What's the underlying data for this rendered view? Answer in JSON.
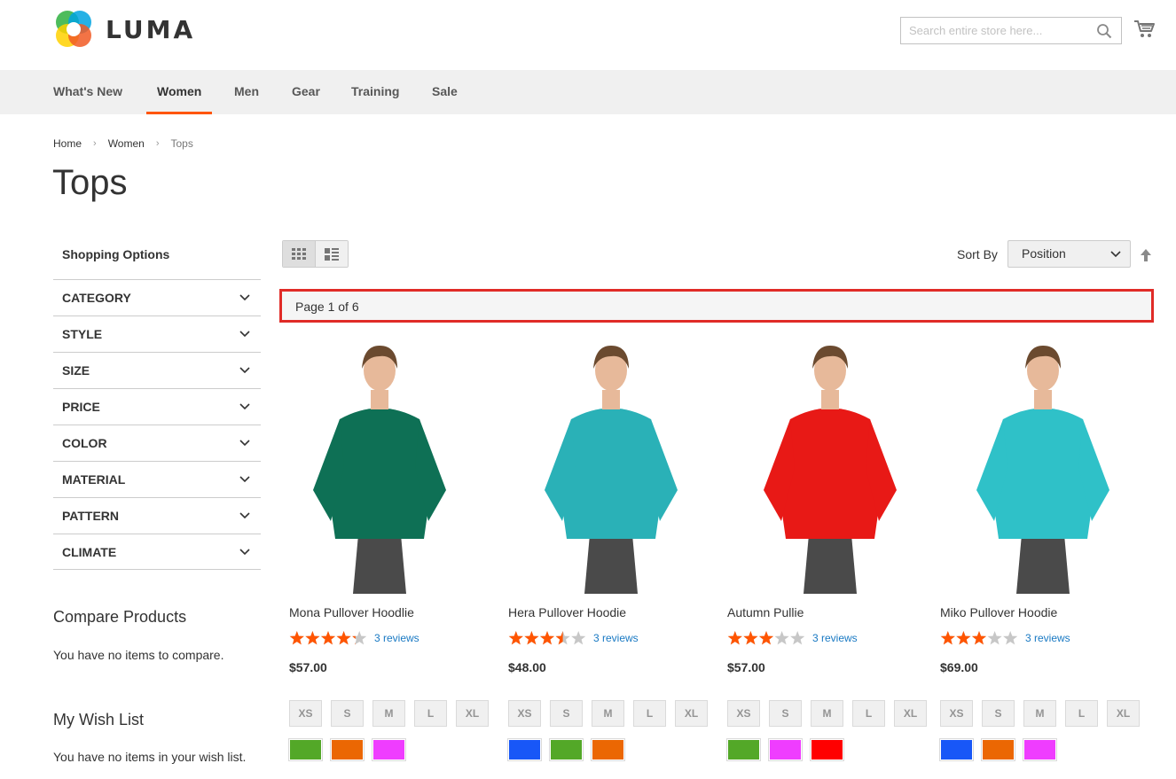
{
  "brand": {
    "name": "LUMA"
  },
  "search": {
    "placeholder": "Search entire store here..."
  },
  "nav": {
    "items": [
      {
        "label": "What's New"
      },
      {
        "label": "Women",
        "active": true
      },
      {
        "label": "Men"
      },
      {
        "label": "Gear"
      },
      {
        "label": "Training"
      },
      {
        "label": "Sale"
      }
    ]
  },
  "breadcrumb": {
    "home": "Home",
    "women": "Women",
    "current": "Tops"
  },
  "page": {
    "title": "Tops"
  },
  "sidebar": {
    "heading": "Shopping Options",
    "filters": [
      "CATEGORY",
      "STYLE",
      "SIZE",
      "PRICE",
      "COLOR",
      "MATERIAL",
      "PATTERN",
      "CLIMATE"
    ],
    "compare_title": "Compare Products",
    "compare_text": "You have no items to compare.",
    "wishlist_title": "My Wish List",
    "wishlist_text": "You have no items in your wish list."
  },
  "toolbar": {
    "sort_label": "Sort By",
    "sort_value": "Position",
    "pager_text": "Page 1 of 6"
  },
  "colors": {
    "accent": "#ff5501",
    "star": "#ff5501",
    "link": "#1979c3",
    "highlight": "#e02b27"
  },
  "products": [
    {
      "name": "Mona Pullover Hoodlie",
      "rating_pct": 85,
      "reviews": "3 reviews",
      "price": "$57.00",
      "sizes": [
        "XS",
        "S",
        "M",
        "L",
        "XL"
      ],
      "swatches": [
        "#53a828",
        "#eb6703",
        "#ef3dff"
      ],
      "garment": "#0e7055"
    },
    {
      "name": "Hera Pullover Hoodie",
      "rating_pct": 70,
      "reviews": "3 reviews",
      "price": "$48.00",
      "sizes": [
        "XS",
        "S",
        "M",
        "L",
        "XL"
      ],
      "swatches": [
        "#1857f7",
        "#53a828",
        "#eb6703"
      ],
      "garment": "#2ab1b7"
    },
    {
      "name": "Autumn Pullie",
      "rating_pct": 60,
      "reviews": "3 reviews",
      "price": "$57.00",
      "sizes": [
        "XS",
        "S",
        "M",
        "L",
        "XL"
      ],
      "swatches": [
        "#53a828",
        "#ef3dff",
        "#ff0000"
      ],
      "garment": "#e81916"
    },
    {
      "name": "Miko Pullover Hoodie",
      "rating_pct": 60,
      "reviews": "3 reviews",
      "price": "$69.00",
      "sizes": [
        "XS",
        "S",
        "M",
        "L",
        "XL"
      ],
      "swatches": [
        "#1857f7",
        "#eb6703",
        "#ef3dff"
      ],
      "garment": "#2fc1c8"
    }
  ]
}
